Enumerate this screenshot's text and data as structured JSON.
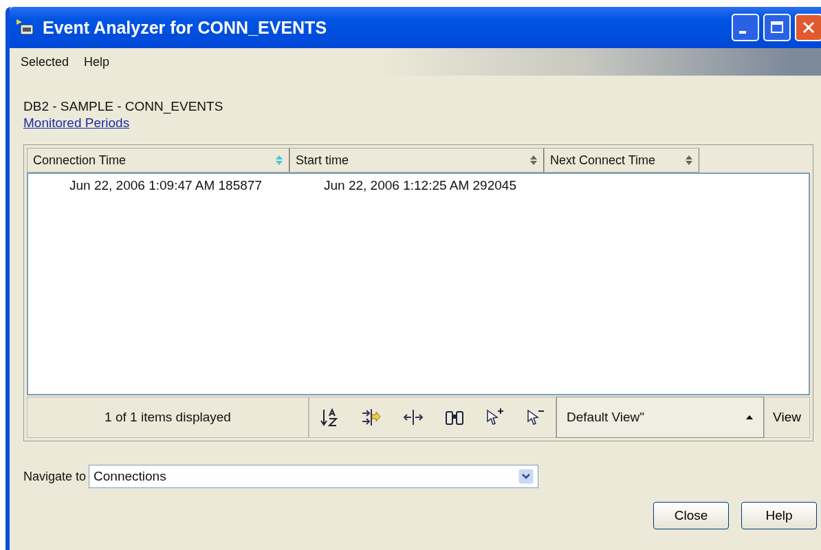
{
  "window": {
    "title": "Event Analyzer for CONN_EVENTS"
  },
  "menu": [
    "Selected",
    "Help"
  ],
  "breadcrumb": "DB2 - SAMPLE - CONN_EVENTS",
  "link": "Monitored Periods",
  "table": {
    "columns": [
      {
        "label": "Connection Time",
        "sorted": true
      },
      {
        "label": "Start time",
        "sorted": false
      },
      {
        "label": "Next Connect Time",
        "sorted": false
      }
    ],
    "rows": [
      [
        "Jun 22, 2006 1:09:47 AM 185877",
        "Jun 22, 2006 1:12:25 AM 292045",
        ""
      ]
    ]
  },
  "footer": {
    "count": "1 of 1 items displayed",
    "view": "Default View\"",
    "view_button": "View"
  },
  "navigate": {
    "label": "Navigate to",
    "value": "Connections"
  },
  "buttons": [
    "Close",
    "Help"
  ]
}
